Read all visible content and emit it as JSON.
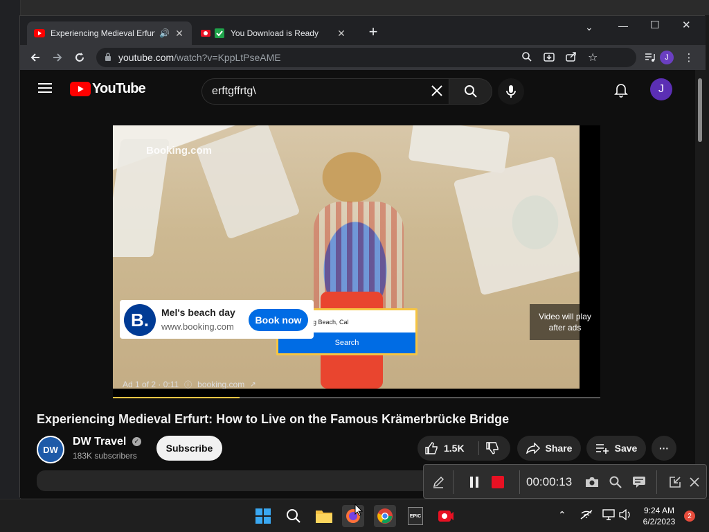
{
  "browser": {
    "tabs": [
      {
        "title": "Experiencing Medieval Erfurt",
        "active": true
      },
      {
        "title": "You Download is Ready",
        "active": false
      }
    ],
    "new_tab": "+",
    "url": {
      "host": "youtube.com",
      "path": "/watch?v=KppLtPseAME"
    },
    "profile_initial": "J",
    "window_controls": {
      "minimize": "—",
      "maximize": "☐",
      "close": "✕",
      "tab_menu": "⌄"
    }
  },
  "youtube": {
    "logo_text": "YouTube",
    "search_query": "erftgffrtg\\",
    "avatar_initial": "J",
    "ad": {
      "brand_watermark": "Booking.com",
      "card_title": "Mel's beach day",
      "card_url": "www.booking.com",
      "logo_letter": "B.",
      "cta": "Book now",
      "form_input": "g Beach, Cal",
      "form_button": "Search",
      "skip_text": "Video will play after ads",
      "ad_counter": "Ad 1 of 2 · 0:11",
      "ad_domain": "booking.com",
      "progress_fraction": 0.26
    },
    "video_title": "Experiencing Medieval Erfurt: How to Live on the Famous Krämerbrücke Bridge",
    "channel": {
      "avatar_text": "DW",
      "name": "DW Travel",
      "subscribers": "183K subscribers",
      "subscribe_label": "Subscribe"
    },
    "actions": {
      "likes": "1.5K",
      "share": "Share",
      "save": "Save",
      "more": "···"
    }
  },
  "recorder": {
    "timer": "00:00:13"
  },
  "taskbar": {
    "time": "9:24 AM",
    "date": "6/2/2023",
    "notification_count": "2",
    "epic_label": "EPIC"
  },
  "colors": {
    "yt_red": "#ff0000",
    "booking_blue": "#003b95",
    "cta_blue": "#006ce4",
    "progress_yellow": "#f6c543",
    "rec_red": "#e81123"
  }
}
